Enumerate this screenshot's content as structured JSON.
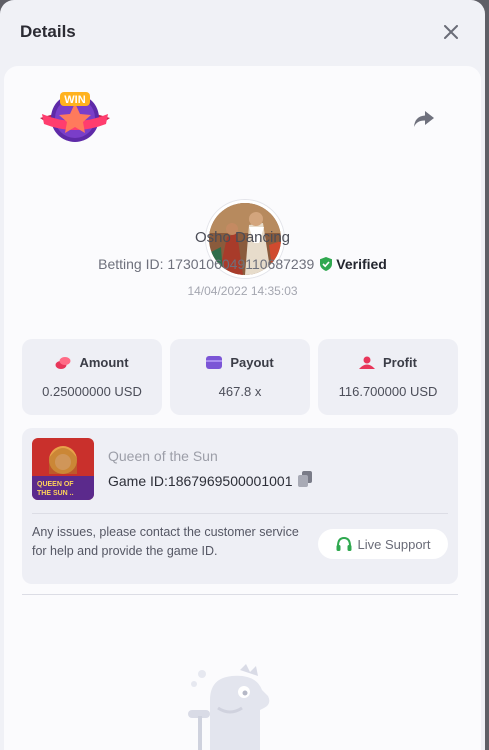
{
  "dialog": {
    "title": "Details"
  },
  "player": {
    "name": "Osho Dancing",
    "betting_id_label": "Betting ID: 1730106049110687239",
    "verified_label": "Verified",
    "timestamp": "14/04/2022 14:35:03"
  },
  "stats": [
    {
      "label": "Amount",
      "value": "0.25000000 USD",
      "icon": "coins-icon",
      "color": "#e8365a"
    },
    {
      "label": "Payout",
      "value": "467.8 x",
      "icon": "wallet-icon",
      "color": "#7b55d6"
    },
    {
      "label": "Profit",
      "value": "116.700000 USD",
      "icon": "profit-icon",
      "color": "#e8365a"
    }
  ],
  "game": {
    "name": "Queen of the Sun",
    "id_label": "Game ID:1867969500001001",
    "thumb_text": "QUEEN OF THE SUN ..."
  },
  "support": {
    "help_text": "Any issues, please contact the customer service for help and provide the game ID.",
    "button_label": "Live Support"
  },
  "badge": {
    "text": "WIN"
  },
  "colors": {
    "verified": "#2fa84f",
    "support_icon": "#2fa84f",
    "accent_red": "#e8365a"
  }
}
